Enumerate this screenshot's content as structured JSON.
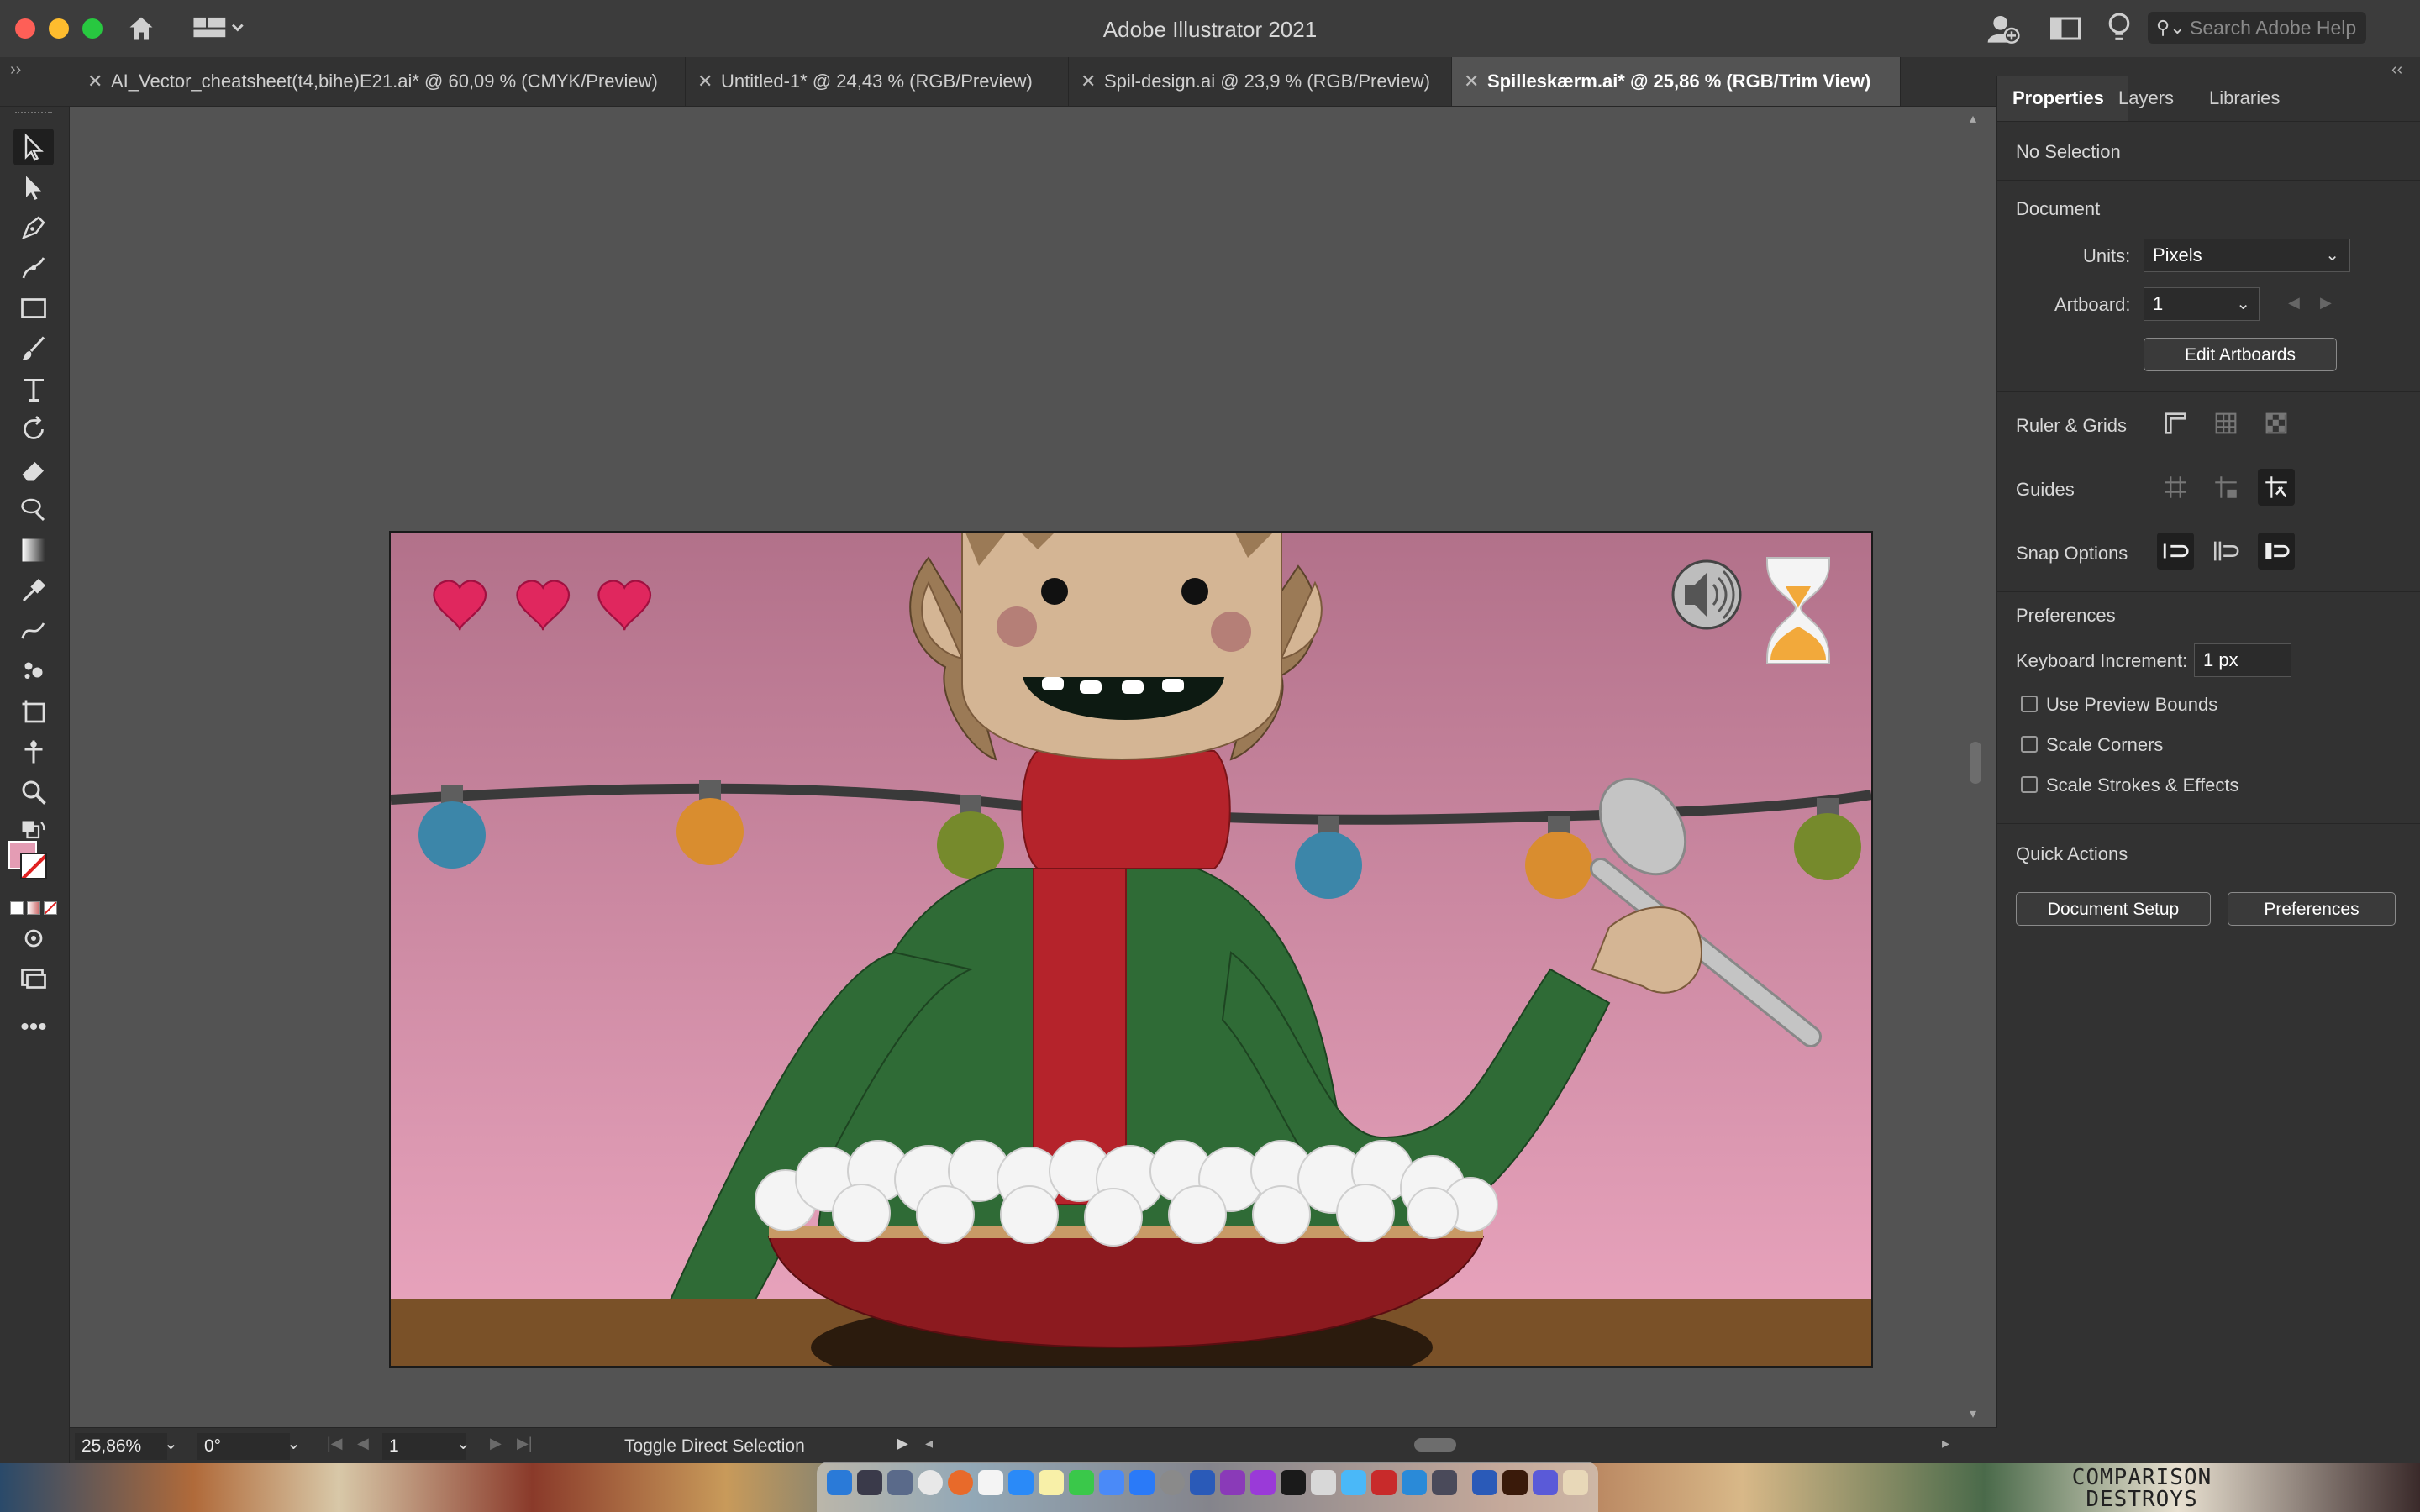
{
  "window": {
    "title": "Adobe Illustrator 2021"
  },
  "search": {
    "placeholder": "Search Adobe Help"
  },
  "tabs": [
    {
      "label": "AI_Vector_cheatsheet(t4,bihe)E21.ai* @ 60,09 % (CMYK/Preview)",
      "active": false
    },
    {
      "label": "Untitled-1* @ 24,43 % (RGB/Preview)",
      "active": false
    },
    {
      "label": "Spil-design.ai @ 23,9 % (RGB/Preview)",
      "active": false
    },
    {
      "label": "Spilleskærm.ai* @ 25,86 % (RGB/Trim View)",
      "active": true
    }
  ],
  "tools": [
    "selection-tool-icon",
    "direct-selection-tool-icon",
    "pen-tool-icon",
    "curvature-tool-icon",
    "rectangle-tool-icon",
    "paintbrush-tool-icon",
    "type-tool-icon",
    "rotate-tool-icon",
    "eraser-tool-icon",
    "shape-builder-tool-icon",
    "gradient-tool-icon",
    "eyedropper-tool-icon",
    "blend-tool-icon",
    "symbol-sprayer-tool-icon",
    "artboard-tool-icon",
    "puppet-warp-tool-icon",
    "zoom-tool-icon"
  ],
  "panel": {
    "tabs": [
      "Properties",
      "Layers",
      "Libraries"
    ],
    "selection_status": "No Selection",
    "document_heading": "Document",
    "units_label": "Units:",
    "units_value": "Pixels",
    "artboard_label": "Artboard:",
    "artboard_value": "1",
    "edit_artboards": "Edit Artboards",
    "ruler_grids": "Ruler & Grids",
    "guides": "Guides",
    "snap_options": "Snap Options",
    "preferences_heading": "Preferences",
    "keyboard_increment_label": "Keyboard Increment:",
    "keyboard_increment_value": "1 px",
    "use_preview_bounds": "Use Preview Bounds",
    "scale_corners": "Scale Corners",
    "scale_strokes": "Scale Strokes & Effects",
    "quick_actions": "Quick Actions",
    "document_setup": "Document Setup",
    "preferences_button": "Preferences"
  },
  "status": {
    "zoom": "25,86%",
    "rotation": "0°",
    "artboard_nav": "1",
    "tool_hint": "Toggle Direct Selection"
  },
  "desktop": {
    "wallpaper_text": "COMPARISON DESTROYS"
  },
  "artwork": {
    "lives": 3,
    "colors": {
      "background_top": "#b97890",
      "background_bottom": "#e8a2ba",
      "table": "#7a5128",
      "sweater": "#2f6b36",
      "scarf": "#b5232b",
      "skin": "#d4b594",
      "hair": "#9b7a56",
      "bowl": "#8c1a1f",
      "cream": "#f4f4f4",
      "heart": "#e0275e",
      "hourglass_sand": "#f2a93b"
    }
  }
}
